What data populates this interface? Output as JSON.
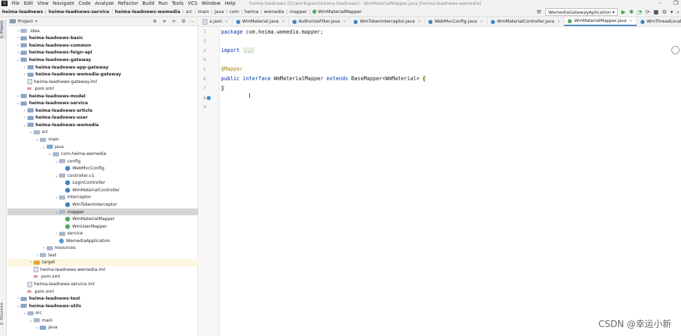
{
  "menu": {
    "items": [
      "File",
      "Edit",
      "View",
      "Navigate",
      "Code",
      "Analyze",
      "Refactor",
      "Build",
      "Run",
      "Tools",
      "VCS",
      "Window",
      "Help"
    ],
    "title": "heima-leadnews [D:\\workspace\\heima-leadnews] - WmMaterialMapper.java [heima-leadnews-wemedia]"
  },
  "breadcrumb": [
    "heima-leadnews",
    "heima-leadnews-service",
    "heima-leadnews-wemedia",
    "src",
    "main",
    "java",
    "com",
    "heima",
    "wemedia",
    "mapper",
    "WmMaterialMapper"
  ],
  "run_config": "WemediaGatewayAplication",
  "project": {
    "title": "Project"
  },
  "side_tabs": {
    "project": "1: Project",
    "structure": "2: Structure"
  },
  "tree": [
    {
      "label": ".idea",
      "indent": 1,
      "arrow": "›",
      "icon": "folder"
    },
    {
      "label": "heima-leadnews-basic",
      "indent": 1,
      "arrow": "›",
      "icon": "module",
      "bold": true
    },
    {
      "label": "heima-leadnews-common",
      "indent": 1,
      "arrow": "›",
      "icon": "module",
      "bold": true
    },
    {
      "label": "heima-leadnews-feign-api",
      "indent": 1,
      "arrow": "›",
      "icon": "module",
      "bold": true
    },
    {
      "label": "heima-leadnews-gateway",
      "indent": 1,
      "arrow": "⌄",
      "icon": "module",
      "bold": true
    },
    {
      "label": "heima-leadnews-app-gateway",
      "indent": 2,
      "arrow": "›",
      "icon": "module",
      "bold": true
    },
    {
      "label": "heima-leadnews-wemedia-gateway",
      "indent": 2,
      "arrow": "›",
      "icon": "module",
      "bold": true
    },
    {
      "label": "heima-leadnews-gateway.iml",
      "indent": 2,
      "arrow": "",
      "icon": "file"
    },
    {
      "label": "pom.xml",
      "indent": 2,
      "arrow": "",
      "icon": "maven"
    },
    {
      "label": "heima-leadnews-model",
      "indent": 1,
      "arrow": "›",
      "icon": "module",
      "bold": true
    },
    {
      "label": "heima-leadnews-service",
      "indent": 1,
      "arrow": "⌄",
      "icon": "module",
      "bold": true
    },
    {
      "label": "heima-leadnews-article",
      "indent": 2,
      "arrow": "›",
      "icon": "module",
      "bold": true
    },
    {
      "label": "heima-leadnews-user",
      "indent": 2,
      "arrow": "›",
      "icon": "module",
      "bold": true
    },
    {
      "label": "heima-leadnews-wemedia",
      "indent": 2,
      "arrow": "⌄",
      "icon": "module",
      "bold": true
    },
    {
      "label": "src",
      "indent": 3,
      "arrow": "⌄",
      "icon": "folder"
    },
    {
      "label": "main",
      "indent": 4,
      "arrow": "⌄",
      "icon": "folder"
    },
    {
      "label": "java",
      "indent": 5,
      "arrow": "⌄",
      "icon": "src"
    },
    {
      "label": "com.heima.wemedia",
      "indent": 6,
      "arrow": "⌄",
      "icon": "folder"
    },
    {
      "label": "config",
      "indent": 7,
      "arrow": "⌄",
      "icon": "folder"
    },
    {
      "label": "WebMvcConfig",
      "indent": 8,
      "arrow": "",
      "icon": "class"
    },
    {
      "label": "controller.v1",
      "indent": 7,
      "arrow": "⌄",
      "icon": "folder"
    },
    {
      "label": "LoginController",
      "indent": 8,
      "arrow": "",
      "icon": "class"
    },
    {
      "label": "WmMaterialController",
      "indent": 8,
      "arrow": "",
      "icon": "class"
    },
    {
      "label": "interceptor",
      "indent": 7,
      "arrow": "⌄",
      "icon": "folder"
    },
    {
      "label": "WmTokenInterceptor",
      "indent": 8,
      "arrow": "",
      "icon": "class"
    },
    {
      "label": "mapper",
      "indent": 7,
      "arrow": "⌄",
      "icon": "folder",
      "selected": true
    },
    {
      "label": "WmMaterialMapper",
      "indent": 8,
      "arrow": "",
      "icon": "interface"
    },
    {
      "label": "WmUserMapper",
      "indent": 8,
      "arrow": "",
      "icon": "interface"
    },
    {
      "label": "service",
      "indent": 7,
      "arrow": "›",
      "icon": "folder"
    },
    {
      "label": "WemediaApplication",
      "indent": 7,
      "arrow": "",
      "icon": "spring"
    },
    {
      "label": "resources",
      "indent": 5,
      "arrow": "›",
      "icon": "folder"
    },
    {
      "label": "test",
      "indent": 4,
      "arrow": "›",
      "icon": "folder"
    },
    {
      "label": "target",
      "indent": 3,
      "arrow": "›",
      "icon": "orange",
      "target": true
    },
    {
      "label": "heima-leadnews-wemedia.iml",
      "indent": 3,
      "arrow": "",
      "icon": "file"
    },
    {
      "label": "pom.xml",
      "indent": 3,
      "arrow": "",
      "icon": "maven"
    },
    {
      "label": "heima-leadnews-service.iml",
      "indent": 2,
      "arrow": "",
      "icon": "file"
    },
    {
      "label": "pom.xml",
      "indent": 2,
      "arrow": "",
      "icon": "maven"
    },
    {
      "label": "heima-leadnews-test",
      "indent": 1,
      "arrow": "›",
      "icon": "module",
      "bold": true
    },
    {
      "label": "heima-leadnews-utils",
      "indent": 1,
      "arrow": "⌄",
      "icon": "module",
      "bold": true
    },
    {
      "label": "src",
      "indent": 2,
      "arrow": "⌄",
      "icon": "folder"
    },
    {
      "label": "main",
      "indent": 3,
      "arrow": "⌄",
      "icon": "folder"
    },
    {
      "label": "java",
      "indent": 4,
      "arrow": "⌄",
      "icon": "src"
    }
  ],
  "tabs": [
    {
      "label": "a.json"
    },
    {
      "label": "WmMaterial.java"
    },
    {
      "label": "AuthorizeFilter.java"
    },
    {
      "label": "WmTokenInterceptor.java"
    },
    {
      "label": "WebMvcConfig.java"
    },
    {
      "label": "WmMaterialController.java"
    },
    {
      "label": "WmMaterialMapper.java",
      "active": true
    },
    {
      "label": "WmThreadLocalUtil.java"
    }
  ],
  "code": {
    "line_numbers": [
      "1",
      "2",
      "3",
      "4",
      "5",
      "6",
      "7",
      "8",
      "9"
    ],
    "package_kw": "package",
    "package_name": " com.heima.wemedia.mapper;",
    "import_kw": "import",
    "import_fold": "...",
    "annotation": "@Mapper",
    "decl_public": "public",
    "decl_interface": "interface",
    "decl_name": " WmMaterialMapper ",
    "decl_extends": "extends",
    "decl_base": " BaseMapper<WmMaterial> ",
    "open_brace": "{",
    "close_brace": "}"
  },
  "watermark": "CSDN @幸运小新"
}
